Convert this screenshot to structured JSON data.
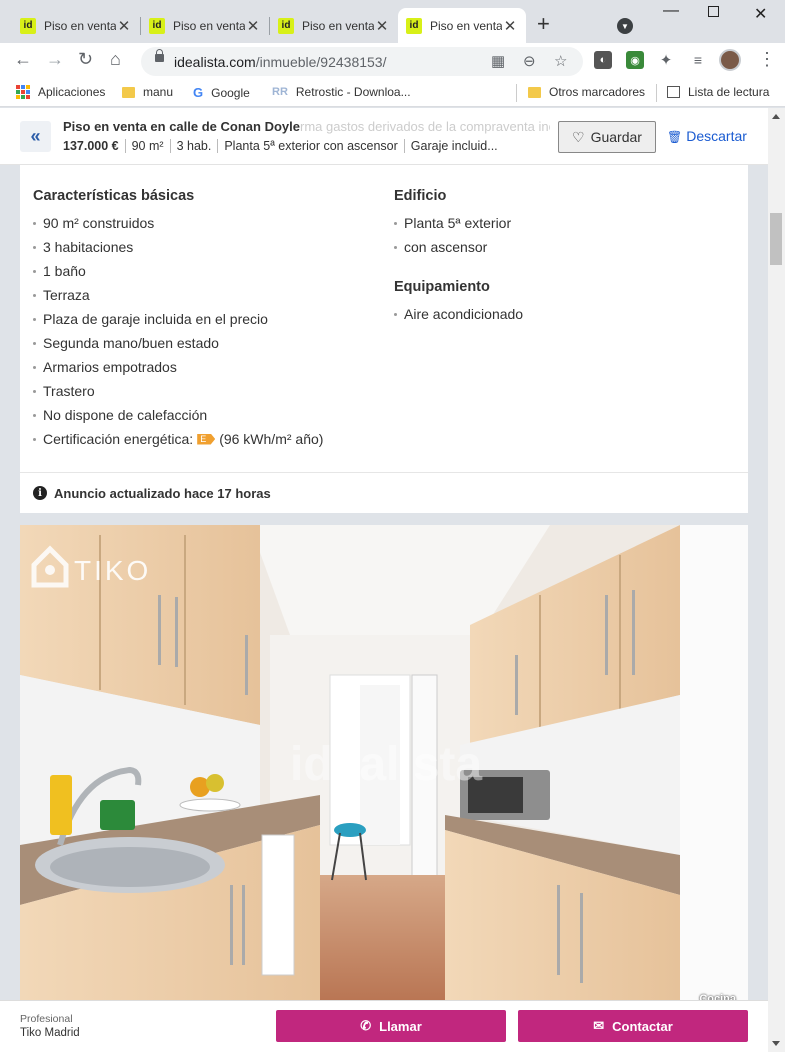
{
  "browser": {
    "tabs": [
      {
        "title": "Piso en venta",
        "favicon": "id"
      },
      {
        "title": "Piso en venta",
        "favicon": "id"
      },
      {
        "title": "Piso en venta",
        "favicon": "id"
      },
      {
        "title": "Piso en venta",
        "favicon": "id"
      }
    ],
    "url_host": "idealista.com",
    "url_path": "/inmueble/92438153/",
    "bookmarks": [
      {
        "label": "Aplicaciones"
      },
      {
        "label": "manu"
      },
      {
        "label": "Google"
      },
      {
        "label": "Retrostic - Downloa..."
      },
      {
        "label": "Otros marcadores"
      },
      {
        "label": "Lista de lectura"
      }
    ]
  },
  "header": {
    "title": "Piso en venta en calle de Conan Doyle",
    "ghost_text": "rma gastos derivados de la compraventa incluido en el",
    "facts": [
      "137.000 €",
      "90 m²",
      "3 hab.",
      "Planta 5ª exterior con ascensor",
      "Garaje incluid..."
    ],
    "save_label": "Guardar",
    "discard_label": "Descartar"
  },
  "features": {
    "basic_title": "Características básicas",
    "basic": [
      "90 m² construidos",
      "3 habitaciones",
      "1 baño",
      "Terraza",
      "Plaza de garaje incluida en el precio",
      "Segunda mano/buen estado",
      "Armarios empotrados",
      "Trastero",
      "No dispone de calefacción"
    ],
    "energy_label": "Certificación energética:",
    "energy_rating": "E",
    "energy_value": "(96 kWh/m² año)",
    "building_title": "Edificio",
    "building": [
      "Planta 5ª exterior",
      "con ascensor"
    ],
    "equipment_title": "Equipamiento",
    "equipment": [
      "Aire acondicionado"
    ]
  },
  "updated_notice": "Anuncio actualizado hace 17 horas",
  "photo": {
    "brand_logo": "TIKO",
    "watermark": "idealista",
    "caption": "Cocina"
  },
  "contact": {
    "type_label": "Profesional",
    "agency": "Tiko Madrid",
    "call_label": "Llamar",
    "contact_label": "Contactar"
  },
  "colors": {
    "accent": "#c1277e",
    "link": "#1a5bd1",
    "energy_e": "#f0a030"
  }
}
